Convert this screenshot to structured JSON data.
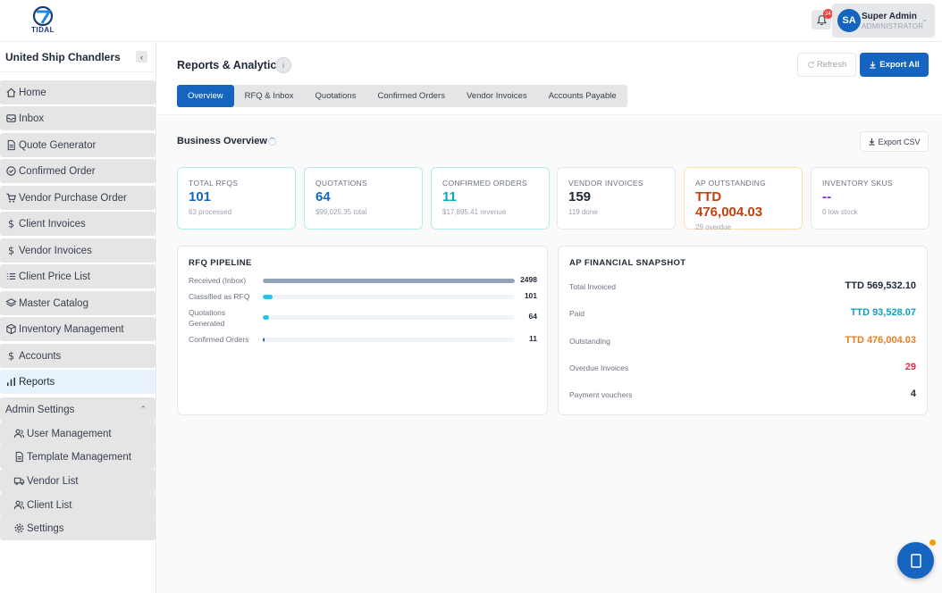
{
  "brand": {
    "logo_text": "TIDAL"
  },
  "header": {
    "notification_count": "24",
    "user_initials": "SA",
    "user_name": "Super Admin",
    "user_role": "ADMINISTRATOR"
  },
  "sidebar": {
    "company": "United Ship Chandlers",
    "items": [
      {
        "label": "Home",
        "icon": "home-icon"
      },
      {
        "label": "Inbox",
        "icon": "inbox-icon"
      },
      {
        "label": "Quote Generator",
        "icon": "document-icon"
      },
      {
        "label": "Confirmed Order",
        "icon": "check-circle-icon"
      },
      {
        "label": "Vendor Purchase Order",
        "icon": "cart-icon"
      },
      {
        "label": "Client Invoices",
        "icon": "dollar-icon"
      },
      {
        "label": "Vendor Invoices",
        "icon": "dollar-icon"
      },
      {
        "label": "Client Price List",
        "icon": "list-icon"
      },
      {
        "label": "Master Catalog",
        "icon": "layers-icon"
      },
      {
        "label": "Inventory Management",
        "icon": "box-icon"
      },
      {
        "label": "Accounts",
        "icon": "dollar-icon"
      },
      {
        "label": "Reports",
        "icon": "bar-chart-icon",
        "active": true
      }
    ],
    "admin_label": "Admin Settings",
    "admin_items": [
      {
        "label": "User Management",
        "icon": "users-icon"
      },
      {
        "label": "Template Management",
        "icon": "document-icon"
      },
      {
        "label": "Vendor List",
        "icon": "truck-icon"
      },
      {
        "label": "Client List",
        "icon": "users-icon"
      },
      {
        "label": "Settings",
        "icon": "gear-icon"
      }
    ]
  },
  "main": {
    "title": "Reports & Analytics",
    "info": "i",
    "refresh_label": "Refresh",
    "export_all_label": "Export All",
    "tabs": [
      "Overview",
      "RFQ & Inbox",
      "Quotations",
      "Confirmed Orders",
      "Vendor Invoices",
      "Accounts Payable"
    ],
    "section_title": "Business Overview",
    "export_csv_label": "Export CSV",
    "kpis": [
      {
        "label": "TOTAL RFQS",
        "value": "101",
        "sub": "63 processed",
        "color": "#1565c0",
        "border": "#b2ebf2"
      },
      {
        "label": "QUOTATIONS",
        "value": "64",
        "sub": "$99,025.35 total",
        "color": "#1565c0",
        "border": "#b2ebf2"
      },
      {
        "label": "CONFIRMED ORDERS",
        "value": "11",
        "sub": "$17,895.41 revenue",
        "color": "#0ea5b7",
        "border": "#b2ebf2"
      },
      {
        "label": "VENDOR INVOICES",
        "value": "159",
        "sub": "119 done",
        "color": "#1f2937",
        "border": "#e5e7eb"
      },
      {
        "label": "AP OUTSTANDING",
        "value": "TTD 476,004.03",
        "sub": "29 overdue",
        "color": "#c2410c",
        "border": "#fde0b0"
      },
      {
        "label": "INVENTORY SKUS",
        "value": "--",
        "sub": "0 low stock",
        "color": "#7e22ce",
        "border": "#e5e7eb"
      }
    ],
    "pipeline": {
      "title": "RFQ PIPELINE",
      "rows": [
        {
          "label": "Received (Inbox)",
          "value": "2498",
          "fraction": 1.0,
          "color": "#94a3b8"
        },
        {
          "label": "Classified as RFQ",
          "value": "101",
          "fraction": 0.04,
          "color": "#22c5e8"
        },
        {
          "label": "Quotations Generated",
          "value": "64",
          "fraction": 0.026,
          "color": "#22c5e8"
        },
        {
          "label": "Confirmed Orders",
          "value": "11",
          "fraction": 0.004,
          "color": "#1565c0"
        }
      ]
    },
    "snapshot": {
      "title": "AP FINANCIAL SNAPSHOT",
      "rows": [
        {
          "label": "Total Invoiced",
          "value": "TTD 569,532.10",
          "color": "#1f2937"
        },
        {
          "label": "Paid",
          "value": "TTD 93,528.07",
          "color": "#0e9fc0"
        },
        {
          "label": "Outstanding",
          "value": "TTD 476,004.03",
          "color": "#e67e22"
        },
        {
          "label": "Overdue Invoices",
          "value": "29",
          "color": "#e0314b"
        },
        {
          "label": "Payment vouchers",
          "value": "4",
          "color": "#1f2937"
        }
      ]
    }
  },
  "colors": {
    "primary": "#1565c0"
  }
}
